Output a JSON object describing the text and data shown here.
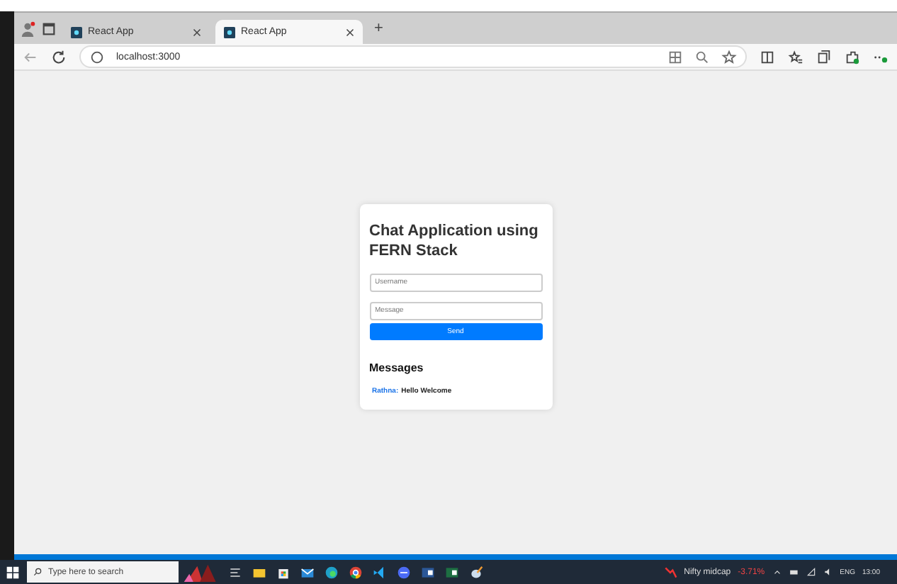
{
  "browser": {
    "tabs": [
      {
        "title": "React App",
        "selected": false
      },
      {
        "title": "React App",
        "selected": true
      }
    ],
    "new_tab": "+",
    "address": "localhost:3000"
  },
  "card": {
    "title": "Chat Application using FERN Stack",
    "username": {
      "placeholder": "Username"
    },
    "message": {
      "placeholder": "Message"
    },
    "send": "Send",
    "messages_heading": "Messages",
    "messages": [
      {
        "user": "Rathna:",
        "text": "Hello Welcome"
      }
    ]
  },
  "taskbar": {
    "search": {
      "placeholder": "Type here to search"
    },
    "ticker": {
      "name": "Nifty midcap",
      "change": "-3.71%"
    },
    "language": "ENG",
    "time": "13:00"
  }
}
